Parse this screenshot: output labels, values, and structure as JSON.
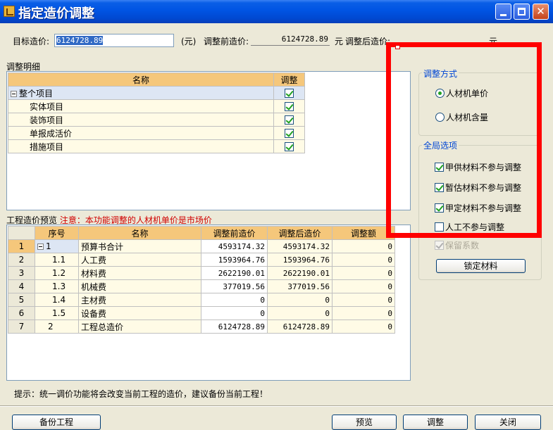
{
  "window": {
    "title": "指定造价调整",
    "min": "_",
    "max": "□",
    "close": "✕"
  },
  "top": {
    "target_label": "目标造价:",
    "target_value": "6124728.89",
    "unit1": "(元)",
    "before_label": "调整前造价:",
    "before_value": "6124728.89",
    "unit2": "元",
    "after_label": "调整后造价:",
    "after_value": "",
    "unit3": "元"
  },
  "detail": {
    "title": "调整明细",
    "headers": [
      "名称",
      "调整"
    ],
    "rows": [
      {
        "name": "整个项目",
        "checked": true
      },
      {
        "name": "实体项目",
        "checked": true
      },
      {
        "name": "装饰项目",
        "checked": true
      },
      {
        "name": "单报成活价",
        "checked": true
      },
      {
        "name": "措施项目",
        "checked": true
      }
    ]
  },
  "preview": {
    "title": "工程造价预览",
    "note": "注意：本功能调整的人材机单价是市场价",
    "headers": [
      "序号",
      "名称",
      "调整前造价",
      "调整后造价",
      "调整额"
    ],
    "rows": [
      {
        "row": "1",
        "seq": "1",
        "name": "预算书合计",
        "before": "4593174.32",
        "after": "4593174.32",
        "diff": "0"
      },
      {
        "row": "2",
        "seq": "1.1",
        "name": "人工费",
        "before": "1593964.76",
        "after": "1593964.76",
        "diff": "0"
      },
      {
        "row": "3",
        "seq": "1.2",
        "name": "材料费",
        "before": "2622190.01",
        "after": "2622190.01",
        "diff": "0"
      },
      {
        "row": "4",
        "seq": "1.3",
        "name": "机械费",
        "before": "377019.56",
        "after": "377019.56",
        "diff": "0"
      },
      {
        "row": "5",
        "seq": "1.4",
        "name": "主材费",
        "before": "0",
        "after": "0",
        "diff": "0"
      },
      {
        "row": "6",
        "seq": "1.5",
        "name": "设备费",
        "before": "0",
        "after": "0",
        "diff": "0"
      },
      {
        "row": "7",
        "seq": "2",
        "name": "工程总造价",
        "before": "6124728.89",
        "after": "6124728.89",
        "diff": "0"
      }
    ]
  },
  "method": {
    "title": "调整方式",
    "opt1": "人材机单价",
    "opt2": "人材机含量"
  },
  "global": {
    "title": "全局选项",
    "opt1": "甲供材料不参与调整",
    "opt2": "暂估材料不参与调整",
    "opt3": "甲定材料不参与调整",
    "opt4": "人工不参与调整",
    "opt5": "保留系数",
    "lock_button": "锁定材料"
  },
  "hint": "提示：统一调价功能将会改变当前工程的造价，建议备份当前工程！",
  "buttons": {
    "backup": "备份工程",
    "preview": "预览",
    "adjust": "调整",
    "close": "关闭"
  },
  "colors": {
    "highlight_frame": "#ff0000",
    "header_bg": "#f5c77b",
    "warning_text": "#d00000"
  }
}
